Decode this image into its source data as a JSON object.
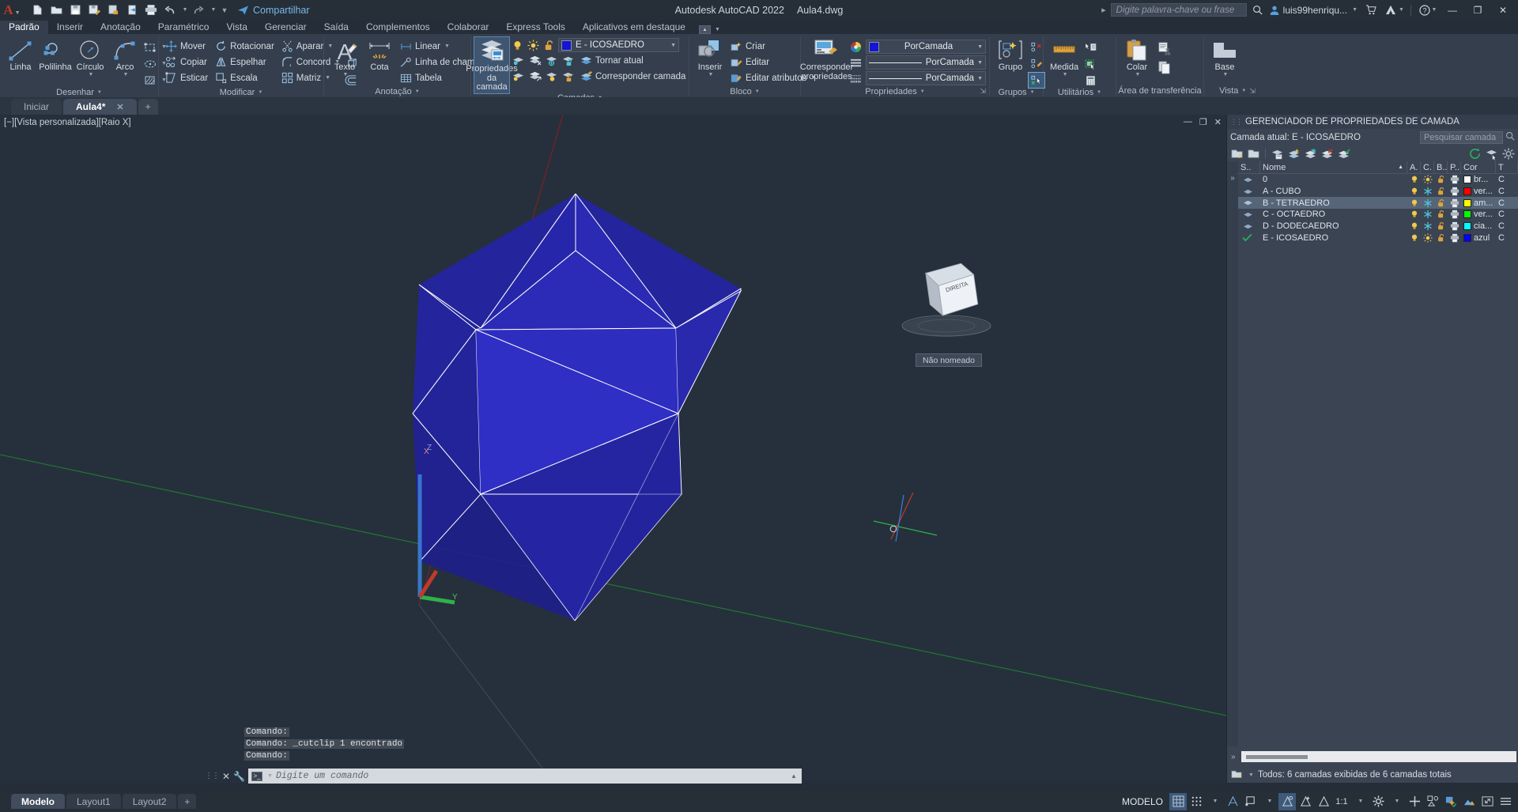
{
  "titlebar": {
    "app_name": "Autodesk AutoCAD 2022",
    "file_name": "Aula4.dwg",
    "share_label": "Compartilhar",
    "search_placeholder": "Digite palavra-chave ou frase",
    "user_name": "luis99henriqu...",
    "quick_access": [
      {
        "name": "new-file-icon",
        "label": "Novo"
      },
      {
        "name": "open-file-icon",
        "label": "Abrir"
      },
      {
        "name": "save-icon",
        "label": "Salvar"
      },
      {
        "name": "save-as-icon",
        "label": "Salvar como"
      },
      {
        "name": "plot-preview-icon",
        "label": "Visualizar"
      },
      {
        "name": "export-icon",
        "label": "Exportar"
      },
      {
        "name": "print-icon",
        "label": "Plotar"
      },
      {
        "name": "undo-icon",
        "label": "Desfazer"
      },
      {
        "name": "redo-icon",
        "label": "Refazer"
      }
    ],
    "window_buttons": {
      "minimize": "—",
      "maximize": "❐",
      "close": "✕"
    }
  },
  "ribbon_tabs": [
    {
      "label": "Padrão",
      "active": true
    },
    {
      "label": "Inserir",
      "active": false
    },
    {
      "label": "Anotação",
      "active": false
    },
    {
      "label": "Paramétrico",
      "active": false
    },
    {
      "label": "Vista",
      "active": false
    },
    {
      "label": "Gerenciar",
      "active": false
    },
    {
      "label": "Saída",
      "active": false
    },
    {
      "label": "Complementos",
      "active": false
    },
    {
      "label": "Colaborar",
      "active": false
    },
    {
      "label": "Express Tools",
      "active": false
    },
    {
      "label": "Aplicativos em destaque",
      "active": false
    }
  ],
  "panels": {
    "draw": {
      "title": "Desenhar",
      "buttons": [
        {
          "label": "Linha",
          "icon": "line-icon"
        },
        {
          "label": "Polilinha",
          "icon": "polyline-icon"
        },
        {
          "label": "Círculo",
          "icon": "circle-icon",
          "has_dropdown": true
        },
        {
          "label": "Arco",
          "icon": "arc-icon",
          "has_dropdown": true
        }
      ],
      "small_icons": [
        {
          "name": "rectangle-icon"
        },
        {
          "name": "ellipse-icon"
        },
        {
          "name": "hatch-icon"
        }
      ]
    },
    "modify": {
      "title": "Modificar",
      "items": [
        {
          "label": "Mover",
          "icon": "move-icon"
        },
        {
          "label": "Rotacionar",
          "icon": "rotate-icon"
        },
        {
          "label": "Aparar",
          "icon": "trim-icon",
          "has_dropdown": true
        },
        {
          "label": "Copiar",
          "icon": "copy-icon"
        },
        {
          "label": "Espelhar",
          "icon": "mirror-icon"
        },
        {
          "label": "Concord",
          "icon": "fillet-icon",
          "has_dropdown": true
        },
        {
          "label": "Esticar",
          "icon": "stretch-icon"
        },
        {
          "label": "Escala",
          "icon": "scale-icon"
        },
        {
          "label": "Matriz",
          "icon": "array-icon",
          "has_dropdown": true
        }
      ],
      "side_icons": [
        {
          "name": "erase-icon"
        },
        {
          "name": "explode-icon"
        },
        {
          "name": "offset-icon"
        }
      ]
    },
    "annotation": {
      "title": "Anotação",
      "big_buttons": [
        {
          "label": "Texto",
          "icon": "text-icon",
          "has_dropdown": true
        },
        {
          "label": "Cota",
          "icon": "dimension-icon"
        }
      ],
      "items": [
        {
          "label": "Linear",
          "icon": "linear-dim-icon",
          "has_dropdown": true
        },
        {
          "label": "Linha de chamada",
          "icon": "leader-icon",
          "has_dropdown": true
        },
        {
          "label": "Tabela",
          "icon": "table-icon"
        }
      ]
    },
    "layers": {
      "title": "Camadas",
      "big_button": {
        "label_line1": "Propriedades",
        "label_line2": "da camada",
        "icon": "layer-properties-icon",
        "selected": true
      },
      "current_layer": "E - ICOSAEDRO",
      "current_layer_color": "#1414d2",
      "actions": [
        {
          "label": "Tornar atual",
          "icon": "make-current-icon"
        },
        {
          "label": "Corresponder camada",
          "icon": "match-layer-icon"
        }
      ],
      "status_icons": [
        "lightbulb-on-icon",
        "sun-icon",
        "unlock-icon"
      ],
      "tool_icons_row1": [
        "layer-isolate-icon",
        "layer-freeze-icon",
        "layer-off-icon",
        "layer-lock-icon"
      ],
      "tool_icons_row2": [
        "layer-unisolate-icon",
        "layer-thaw-icon",
        "layer-on-icon",
        "layer-unlock-icon"
      ]
    },
    "block": {
      "title": "Bloco",
      "big_button": {
        "label": "Inserir",
        "icon": "insert-block-icon",
        "has_dropdown": true
      },
      "items": [
        {
          "label": "Criar",
          "icon": "create-block-icon"
        },
        {
          "label": "Editar",
          "icon": "edit-block-icon"
        },
        {
          "label": "Editar atributos",
          "icon": "edit-attributes-icon",
          "has_dropdown": true
        }
      ]
    },
    "properties": {
      "title": "Propriedades",
      "big_button": {
        "label_line1": "Corresponder",
        "label_line2": "propriedades",
        "icon": "match-properties-icon"
      },
      "color_value": "PorCamada",
      "color_swatch": "#1414d2",
      "linetype_value": "PorCamada",
      "lineweight_value": "PorCamada",
      "icons": [
        "color-wheel-icon",
        "linetype-icon",
        "lineweight-icon"
      ]
    },
    "groups": {
      "title": "Grupos",
      "big_button": {
        "label": "Grupo",
        "icon": "group-icon"
      },
      "side_icons": [
        {
          "name": "ungroup-icon"
        },
        {
          "name": "group-edit-icon"
        },
        {
          "name": "group-selection-icon",
          "selected": true
        }
      ]
    },
    "utilities": {
      "title": "Utilitários",
      "big_button": {
        "label": "Medida",
        "icon": "measure-icon",
        "has_dropdown": true
      },
      "side_icons": [
        {
          "name": "quick-select-icon"
        },
        {
          "name": "select-all-icon"
        },
        {
          "name": "calculator-icon"
        }
      ]
    },
    "clipboard": {
      "title": "Área de transferência",
      "big_button": {
        "label": "Colar",
        "icon": "paste-icon",
        "has_dropdown": true
      },
      "side_icons": [
        {
          "name": "cut-icon"
        },
        {
          "name": "copy-clip-icon"
        }
      ]
    },
    "view": {
      "title": "Vista",
      "big_button": {
        "label": "Base",
        "icon": "base-view-icon",
        "has_dropdown": true
      }
    }
  },
  "file_tabs": [
    {
      "label": "Iniciar",
      "active": false,
      "closable": false
    },
    {
      "label": "Aula4*",
      "active": true,
      "closable": true
    }
  ],
  "file_tab_add": "+",
  "viewport": {
    "label": "[−][Vista personalizada][Raio X]",
    "viewcube_label": "DIREITA",
    "ucs_label": "Não nomeado",
    "axis_x": "X",
    "axis_y": "Y",
    "axis_z": "Z",
    "solid_fill": "#2222a8",
    "solid_edge": "#ffffff"
  },
  "command_area": {
    "history": [
      "Comando:",
      "Comando: _cutclip 1 encontrado",
      "Comando:"
    ],
    "placeholder": "Digite um comando"
  },
  "layout_tabs": [
    {
      "label": "Modelo",
      "active": true
    },
    {
      "label": "Layout1",
      "active": false
    },
    {
      "label": "Layout2",
      "active": false
    }
  ],
  "layout_add": "+",
  "status_bar": {
    "model_label": "MODELO",
    "scale": "1:1",
    "icons": [
      {
        "name": "model-space-icon",
        "on": false
      },
      {
        "name": "grid-display-icon",
        "on": true
      },
      {
        "name": "snap-mode-icon",
        "on": false
      },
      {
        "name": "infer-constraints-icon",
        "on": false
      },
      {
        "name": "ortho-mode-icon",
        "on": false
      },
      {
        "name": "polar-tracking-icon",
        "on": false
      },
      {
        "name": "object-snap-icon",
        "on": false
      },
      {
        "name": "3d-object-snap-icon",
        "on": true
      },
      {
        "name": "otrack-icon",
        "on": false
      },
      {
        "name": "dynamic-ucs-icon",
        "on": false
      },
      {
        "name": "dynamic-input-icon",
        "on": false
      },
      {
        "name": "lineweight-icon",
        "on": false
      },
      {
        "name": "transparency-icon",
        "on": false
      },
      {
        "name": "selection-cycling-icon",
        "on": false
      },
      {
        "name": "annotation-monitor-icon",
        "on": false
      },
      {
        "name": "annotation-scale-icon",
        "on": false
      },
      {
        "name": "workspace-icon",
        "on": false
      },
      {
        "name": "customization-icon",
        "on": false
      },
      {
        "name": "hardware-accel-icon",
        "on": false
      },
      {
        "name": "isolate-objects-icon",
        "on": false
      },
      {
        "name": "fullscreen-icon",
        "on": false
      },
      {
        "name": "menu-icon",
        "on": false
      }
    ]
  },
  "layer_palette": {
    "title": "GERENCIADOR DE PROPRIEDADES DE CAMADA",
    "current_layer_label": "Camada atual: E - ICOSAEDRO",
    "search_placeholder": "Pesquisar camada",
    "toolbar_icons": [
      {
        "name": "new-layer-icon"
      },
      {
        "name": "new-layer-vp-frozen-icon"
      },
      {
        "name": "delete-layer-icon"
      },
      {
        "name": "set-current-icon"
      },
      {
        "name": "layer-states-icon"
      },
      {
        "name": "layer-filter-icon"
      },
      {
        "name": "layer-check-icon"
      }
    ],
    "toolbar_right_icons": [
      {
        "name": "refresh-icon"
      },
      {
        "name": "layer-walk-icon"
      },
      {
        "name": "settings-gear-icon"
      }
    ],
    "columns": [
      {
        "key": "status",
        "label": "S.."
      },
      {
        "key": "name",
        "label": "Nome"
      },
      {
        "key": "on",
        "label": "A."
      },
      {
        "key": "freeze",
        "label": "C."
      },
      {
        "key": "lock",
        "label": "B.."
      },
      {
        "key": "plot",
        "label": "P.."
      },
      {
        "key": "color",
        "label": "Cor"
      },
      {
        "key": "linetype",
        "label": "T"
      }
    ],
    "rows": [
      {
        "status": "layer-icon",
        "name": "0",
        "on": true,
        "freeze": "sun",
        "lock": "unlocked",
        "plot": true,
        "color_name": "br...",
        "color_hex": "#ffffff",
        "selected": false,
        "current": false
      },
      {
        "status": "layer-icon",
        "name": "A - CUBO",
        "on": true,
        "freeze": "snowflake",
        "lock": "unlocked",
        "plot": true,
        "color_name": "ver...",
        "color_hex": "#ff0000",
        "selected": false,
        "current": false
      },
      {
        "status": "layer-icon",
        "name": "B - TETRAEDRO",
        "on": true,
        "freeze": "snowflake",
        "lock": "unlocked",
        "plot": true,
        "color_name": "am...",
        "color_hex": "#ffff00",
        "selected": true,
        "current": false
      },
      {
        "status": "layer-icon",
        "name": "C - OCTAEDRO",
        "on": true,
        "freeze": "snowflake",
        "lock": "unlocked",
        "plot": true,
        "color_name": "ver...",
        "color_hex": "#00ff00",
        "selected": false,
        "current": false
      },
      {
        "status": "layer-icon",
        "name": "D - DODECAEDRO",
        "on": true,
        "freeze": "snowflake",
        "lock": "unlocked",
        "plot": true,
        "color_name": "cia...",
        "color_hex": "#00ffff",
        "selected": false,
        "current": false
      },
      {
        "status": "current-check-icon",
        "name": "E - ICOSAEDRO",
        "on": true,
        "freeze": "sun",
        "lock": "unlocked",
        "plot": true,
        "color_name": "azul",
        "color_hex": "#0000ff",
        "selected": false,
        "current": true
      }
    ],
    "footer_status": "Todos: 6 camadas exibidas de 6 camadas totais",
    "filter_icon": "layer-filter-dropdown-icon"
  }
}
